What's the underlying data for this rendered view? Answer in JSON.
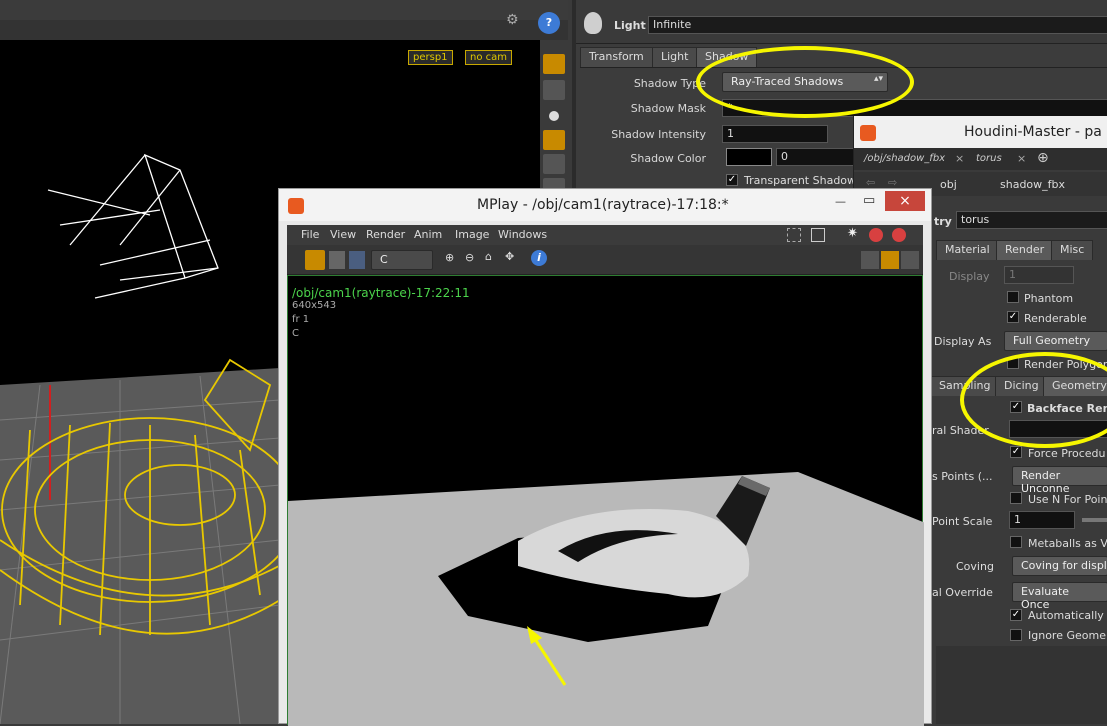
{
  "viewport": {
    "persp_menu": "persp1",
    "cam_menu": "no cam"
  },
  "light_panel": {
    "type_label": "Light",
    "name_value": "Infinite",
    "tabs": [
      "Transform",
      "Light",
      "Shadow"
    ],
    "shadow_type_label": "Shadow Type",
    "shadow_type_value": "Ray-Traced Shadows",
    "shadow_mask_label": "Shadow Mask",
    "shadow_mask_value": "*",
    "shadow_intensity_label": "Shadow Intensity",
    "shadow_intensity_value": "1",
    "shadow_color_label": "Shadow Color",
    "shadow_color_value": "0",
    "transparent_shadows_label": "Transparent Shadow"
  },
  "master": {
    "title": "Houdini-Master - pa",
    "tabs": [
      "/obj/shadow_fbx",
      "torus"
    ],
    "path": [
      "obj",
      "shadow_fbx"
    ],
    "geo_label": "try",
    "geo_value": "torus",
    "main_tabs": [
      "Material",
      "Render",
      "Misc"
    ],
    "display_label": "Display",
    "display_value": "1",
    "phantom_label": "Phantom",
    "renderable_label": "Renderable",
    "display_as_label": "Display As",
    "display_as_value": "Full Geometry",
    "render_polygons_label": "Render Polygon",
    "sub_tabs": [
      "Sampling",
      "Dicing",
      "Geometry"
    ],
    "backface_label": "Backface Rem",
    "shader_label": "ral Shader",
    "force_procedural_label": "Force Procedu",
    "points_label": "s Points (...",
    "points_value": "Render Unconne",
    "use_n_label": "Use N For Poin",
    "point_scale_label": "Point Scale",
    "point_scale_value": "1",
    "metaballs_label": "Metaballs as V",
    "coving_label": "Coving",
    "coving_value": "Coving for displa",
    "override_label": "al Override",
    "override_value": "Evaluate Once",
    "automatically_label": "Automatically",
    "ignore_geo_label": "Ignore Geome"
  },
  "mplay": {
    "title": "MPlay - /obj/cam1(raytrace)-17:18:*",
    "menu": [
      "File",
      "View",
      "Render",
      "Anim",
      "Image",
      "Windows"
    ],
    "channel": "C",
    "overlay_path": "/obj/cam1(raytrace)-17:22:11",
    "overlay_res": "640x543",
    "overlay_frame": "fr 1",
    "overlay_channel": "C"
  },
  "colors": {
    "highlight": "#f6f600",
    "wire": "#e8c800",
    "overlay_green": "#4cd44c"
  }
}
